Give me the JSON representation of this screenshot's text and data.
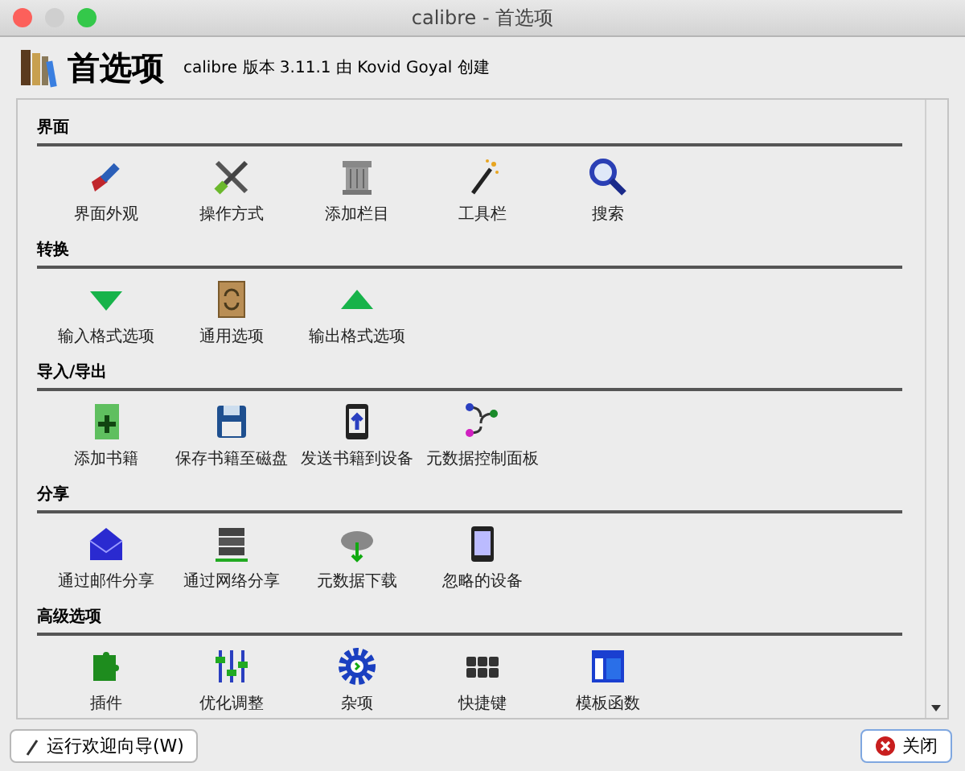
{
  "window": {
    "title": "calibre - 首选项"
  },
  "header": {
    "title": "首选项",
    "subtitle": "calibre 版本 3.11.1 由 Kovid Goyal 创建"
  },
  "sections": [
    {
      "title": "界面",
      "items": [
        {
          "label": "界面外观"
        },
        {
          "label": "操作方式"
        },
        {
          "label": "添加栏目"
        },
        {
          "label": "工具栏"
        },
        {
          "label": "搜索"
        }
      ]
    },
    {
      "title": "转换",
      "items": [
        {
          "label": "输入格式选项"
        },
        {
          "label": "通用选项"
        },
        {
          "label": "输出格式选项"
        }
      ]
    },
    {
      "title": "导入/导出",
      "items": [
        {
          "label": "添加书籍"
        },
        {
          "label": "保存书籍至磁盘"
        },
        {
          "label": "发送书籍到设备"
        },
        {
          "label": "元数据控制面板"
        }
      ]
    },
    {
      "title": "分享",
      "items": [
        {
          "label": "通过邮件分享"
        },
        {
          "label": "通过网络分享"
        },
        {
          "label": "元数据下载"
        },
        {
          "label": "忽略的设备"
        }
      ]
    },
    {
      "title": "高级选项",
      "items": [
        {
          "label": "插件"
        },
        {
          "label": "优化调整"
        },
        {
          "label": "杂项"
        },
        {
          "label": "快捷键"
        },
        {
          "label": "模板函数"
        }
      ]
    }
  ],
  "footer": {
    "wizard_button": "运行欢迎向导(W)",
    "close_button": "关闭"
  }
}
